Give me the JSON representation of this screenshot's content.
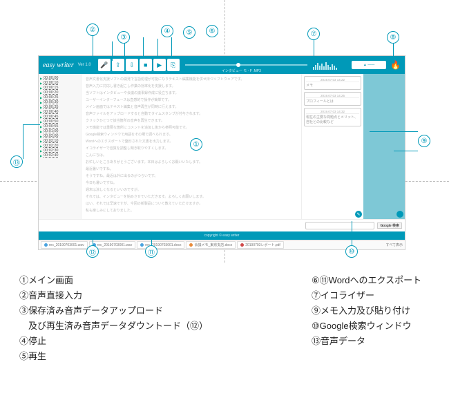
{
  "app": {
    "logo": "easy writer",
    "version": "Ver 1.0",
    "scrub_label": "インタビュー モ - F .MP3",
    "user_label": "▲ ——",
    "footer": "copyright © easy writer"
  },
  "toolbar": {
    "mic": "🎤",
    "upload": "⇪",
    "download": "⇩",
    "stop": "■",
    "play": "▶",
    "export": "⎘"
  },
  "timestamps": [
    "00:00:00",
    "00:00:10",
    "00:00:15",
    "00:00:20",
    "00:00:25",
    "00:00:30",
    "00:00:35",
    "00:00:40",
    "00:00:45",
    "00:00:50",
    "00:00:55",
    "00:01:00",
    "00:02:00",
    "00:02:10",
    "00:02:20",
    "00:02:30",
    "00:02:40"
  ],
  "main_lines": [
    "音声文書化支援ソフトの開発で言語処理が可能になりテキスト編集機能を併せ持つソフトウェアです。",
    "音声入力に対応し書き起こし作業の効率化を支援します。",
    "当ソフトはインタビューや会議の議事録作成に役立ちます。",
    "ユーザーインターフェースは直感的で操作が簡単です。",
    "メイン画面ではテキスト編集と音声再生が同時に行えます。",
    "音声ファイルをアップロードすると自動でタイムスタンプが付与されます。",
    "クリックひとつで該当箇所の音声を再生できます。",
    "メモ機能では重要な箇所にコメントを追加し後から参照可能です。",
    "Google検索ウィンドウで用語をその場で調べられます。",
    "Wordへのエクスポートで整形された文書を出力します。",
    "イコライザーで音質を調整し聞き取りやすくします。",
    "こんにちは。",
    "お忙しいところありがとうございます。本日はよろしくお願いいたします。",
    "最近暑いですね。",
    "そうですね。最近は外に出るのがつらいです。",
    "今日も暑いですね。",
    "週末は涼しくなるといいのですが。",
    "それでは、インタビューを始めさせていただきます。よろしくお願いします。",
    "はい、それでは早速ですが、今回の新製品について教えていただけますか。",
    "私も楽しみにしておりました。"
  ],
  "notes": [
    {
      "ts": "2019.07.03 14:22",
      "body": "メモ"
    },
    {
      "ts": "2019.07.03 14:25",
      "body": "プロフィールとは"
    },
    {
      "ts": "2019.07.03 14:32",
      "body": "現在の主要な問題点とメリット、自社との比較など"
    }
  ],
  "search": {
    "placeholder": "",
    "button": "Google 検索"
  },
  "files": [
    {
      "name": "rec_20190703001.wav",
      "color": "#4aa3df"
    },
    {
      "name": "rec_20190703001.wav",
      "color": "#4aa3df"
    },
    {
      "name": "rec_20190703001.docx",
      "color": "#4aa3df"
    },
    {
      "name": "会議メモ_東京支店.docx",
      "color": "#e88b3a"
    },
    {
      "name": "20190703レポート.pdf",
      "color": "#d04a4a"
    }
  ],
  "files_right": "すべて表示",
  "callouts": {
    "1": "①",
    "2": "②",
    "3": "③",
    "4": "④",
    "5": "⑤",
    "6": "⑥",
    "7": "⑦",
    "8": "⑧",
    "9": "⑨",
    "10": "⑩",
    "11": "⑪",
    "12": "⑫",
    "13": "⑬"
  },
  "legend_left": [
    "①メイン画面",
    "②音声直接入力",
    "③保存済み音声データアップロード",
    "　及び再生済み音声データダウントード（⑫）",
    "④停止",
    "⑤再生"
  ],
  "legend_right": [
    "⑥⑪Wordへのエクスポート",
    "⑦イコライザー",
    "⑨メモ入力及び貼り付け",
    "⑩Google検索ウィンドウ",
    "⑬音声データ"
  ]
}
